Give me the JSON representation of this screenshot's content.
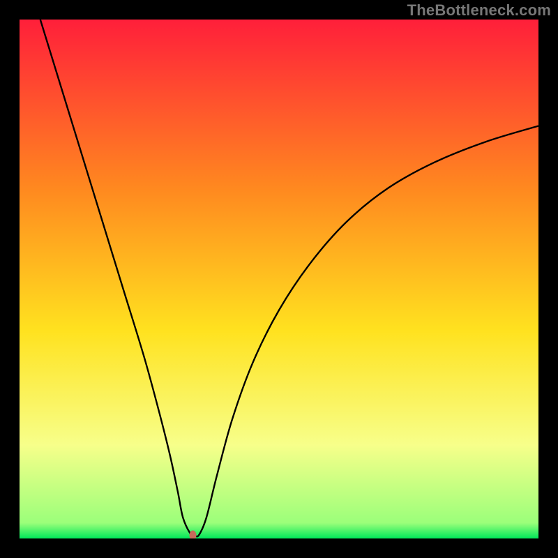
{
  "watermark": "TheBottleneck.com",
  "chart_data": {
    "type": "line",
    "title": "",
    "xlabel": "",
    "ylabel": "",
    "xlim": [
      0,
      100
    ],
    "ylim": [
      0,
      100
    ],
    "background_gradient": {
      "stops": [
        {
          "offset": 0,
          "color": "#ff1f3a"
        },
        {
          "offset": 33,
          "color": "#ff8a1f"
        },
        {
          "offset": 60,
          "color": "#ffe21f"
        },
        {
          "offset": 82,
          "color": "#f7ff8a"
        },
        {
          "offset": 97,
          "color": "#9bff7a"
        },
        {
          "offset": 100,
          "color": "#00e85a"
        }
      ]
    },
    "series": [
      {
        "name": "bottleneck-curve",
        "color": "#000000",
        "x": [
          4,
          8,
          12,
          16,
          20,
          24,
          27,
          29,
          30.5,
          31.5,
          33,
          33.8,
          34.6,
          36,
          38,
          41,
          45,
          50,
          56,
          63,
          71,
          80,
          90,
          100
        ],
        "y": [
          100,
          87,
          74,
          61,
          48,
          35,
          24,
          16,
          9,
          4,
          0.8,
          0.5,
          0.7,
          4,
          12,
          23,
          34,
          44,
          53,
          61,
          67.5,
          72.5,
          76.5,
          79.5
        ]
      }
    ],
    "marker": {
      "name": "optimal-point",
      "x": 33.4,
      "y": 0.6,
      "color": "#c66a5a",
      "rx": 5,
      "ry": 7
    }
  }
}
